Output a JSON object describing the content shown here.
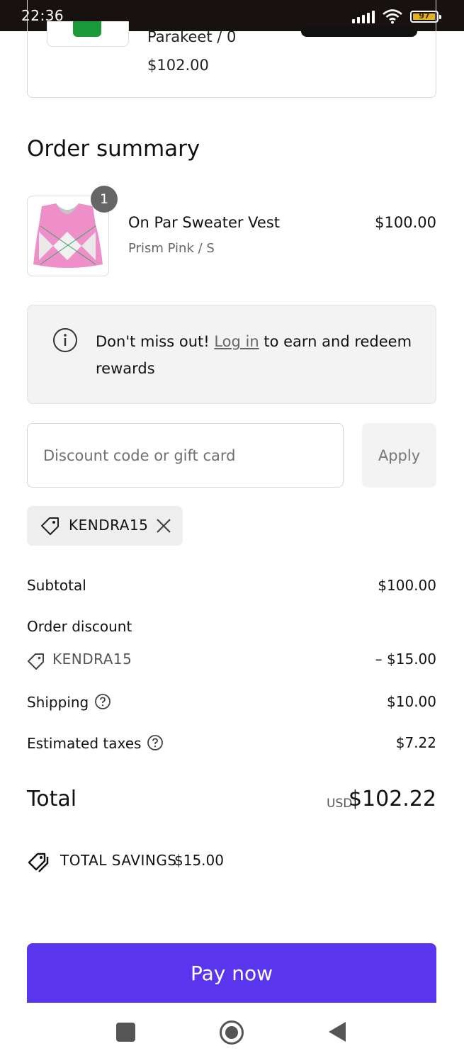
{
  "status_bar": {
    "time": "22:36",
    "battery": "97",
    "battery_level": 0.97
  },
  "previous_item": {
    "variant": "Parakeet / 0",
    "price": "$102.00"
  },
  "order_summary": {
    "title": "Order summary",
    "item": {
      "quantity": "1",
      "name": "On Par Sweater Vest",
      "variant": "Prism Pink / S",
      "price": "$100.00"
    }
  },
  "info": {
    "prefix": "Don't miss out! ",
    "link": "Log in",
    "suffix": " to earn and redeem rewards"
  },
  "discount": {
    "placeholder": "Discount code or gift card",
    "apply_label": "Apply",
    "applied_code": "KENDRA15"
  },
  "totals": {
    "subtotal_label": "Subtotal",
    "subtotal_value": "$100.00",
    "order_discount_label": "Order discount",
    "discount_code": "KENDRA15",
    "discount_value": "– $15.00",
    "shipping_label": "Shipping",
    "shipping_value": "$10.00",
    "taxes_label": "Estimated taxes",
    "taxes_value": "$7.22",
    "total_label": "Total",
    "currency": "USD",
    "total_value": "$102.22",
    "savings_label": "TOTAL SAVINGS",
    "savings_value": "$15.00"
  },
  "pay_button": {
    "label": "Pay now"
  },
  "colors": {
    "accent": "#5a35ee",
    "panel": "#f3f3f3",
    "badge": "#666666"
  },
  "icons": [
    "info-icon",
    "tag-icon",
    "close-icon",
    "question-icon",
    "savings-tag-icon"
  ]
}
